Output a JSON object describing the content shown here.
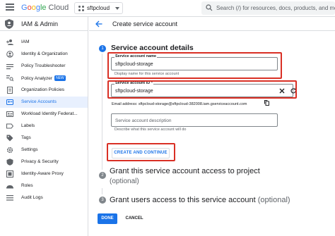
{
  "header": {
    "logo_parts": [
      "G",
      "o",
      "o",
      "g",
      "le",
      " Cloud"
    ],
    "project": "sftpcloud",
    "search_placeholder": "Search (/) for resources, docs, products, and more"
  },
  "sidebar": {
    "title": "IAM & Admin",
    "items": [
      {
        "label": "IAM",
        "icon": "person-add-icon"
      },
      {
        "label": "Identity & Organization",
        "icon": "person-circle-icon"
      },
      {
        "label": "Policy Troubleshooter",
        "icon": "wrench-icon"
      },
      {
        "label": "Policy Analyzer",
        "icon": "list-search-icon",
        "badge": "NEW"
      },
      {
        "label": "Organization Policies",
        "icon": "document-icon"
      },
      {
        "label": "Service Accounts",
        "icon": "service-account-icon",
        "active": true
      },
      {
        "label": "Workload Identity Federat...",
        "icon": "id-card-icon"
      },
      {
        "label": "Labels",
        "icon": "label-icon"
      },
      {
        "label": "Tags",
        "icon": "tag-icon"
      },
      {
        "label": "Settings",
        "icon": "gear-icon"
      },
      {
        "label": "Privacy & Security",
        "icon": "shield-icon"
      },
      {
        "label": "Identity-Aware Proxy",
        "icon": "iap-icon"
      },
      {
        "label": "Roles",
        "icon": "hat-icon"
      },
      {
        "label": "Audit Logs",
        "icon": "list-icon"
      }
    ]
  },
  "main": {
    "page_title": "Create service account",
    "step1": {
      "number": "1",
      "title": "Service account details",
      "name_field": {
        "label": "Service account name",
        "value": "sftpcloud-storage",
        "hint": "Display name for this service account"
      },
      "id_field": {
        "label": "Service account ID *",
        "value": "sftpcloud-storage"
      },
      "email_text": "Email address: sftpcloud-storage@sftpcloud-382008.iam.gserviceaccount.com",
      "desc_field": {
        "placeholder": "Service account description",
        "hint": "Describe what this service account will do"
      },
      "create_button": "CREATE AND CONTINUE"
    },
    "step2": {
      "number": "2",
      "title": "Grant this service account access to project",
      "optional": "(optional)"
    },
    "step3": {
      "number": "3",
      "title": "Grant users access to this service account",
      "optional": "(optional)"
    },
    "done_button": "DONE",
    "cancel_button": "CANCEL"
  },
  "colors": {
    "accent": "#1a73e8",
    "highlight": "#d93025",
    "active_bg": "#e8f0fe"
  }
}
